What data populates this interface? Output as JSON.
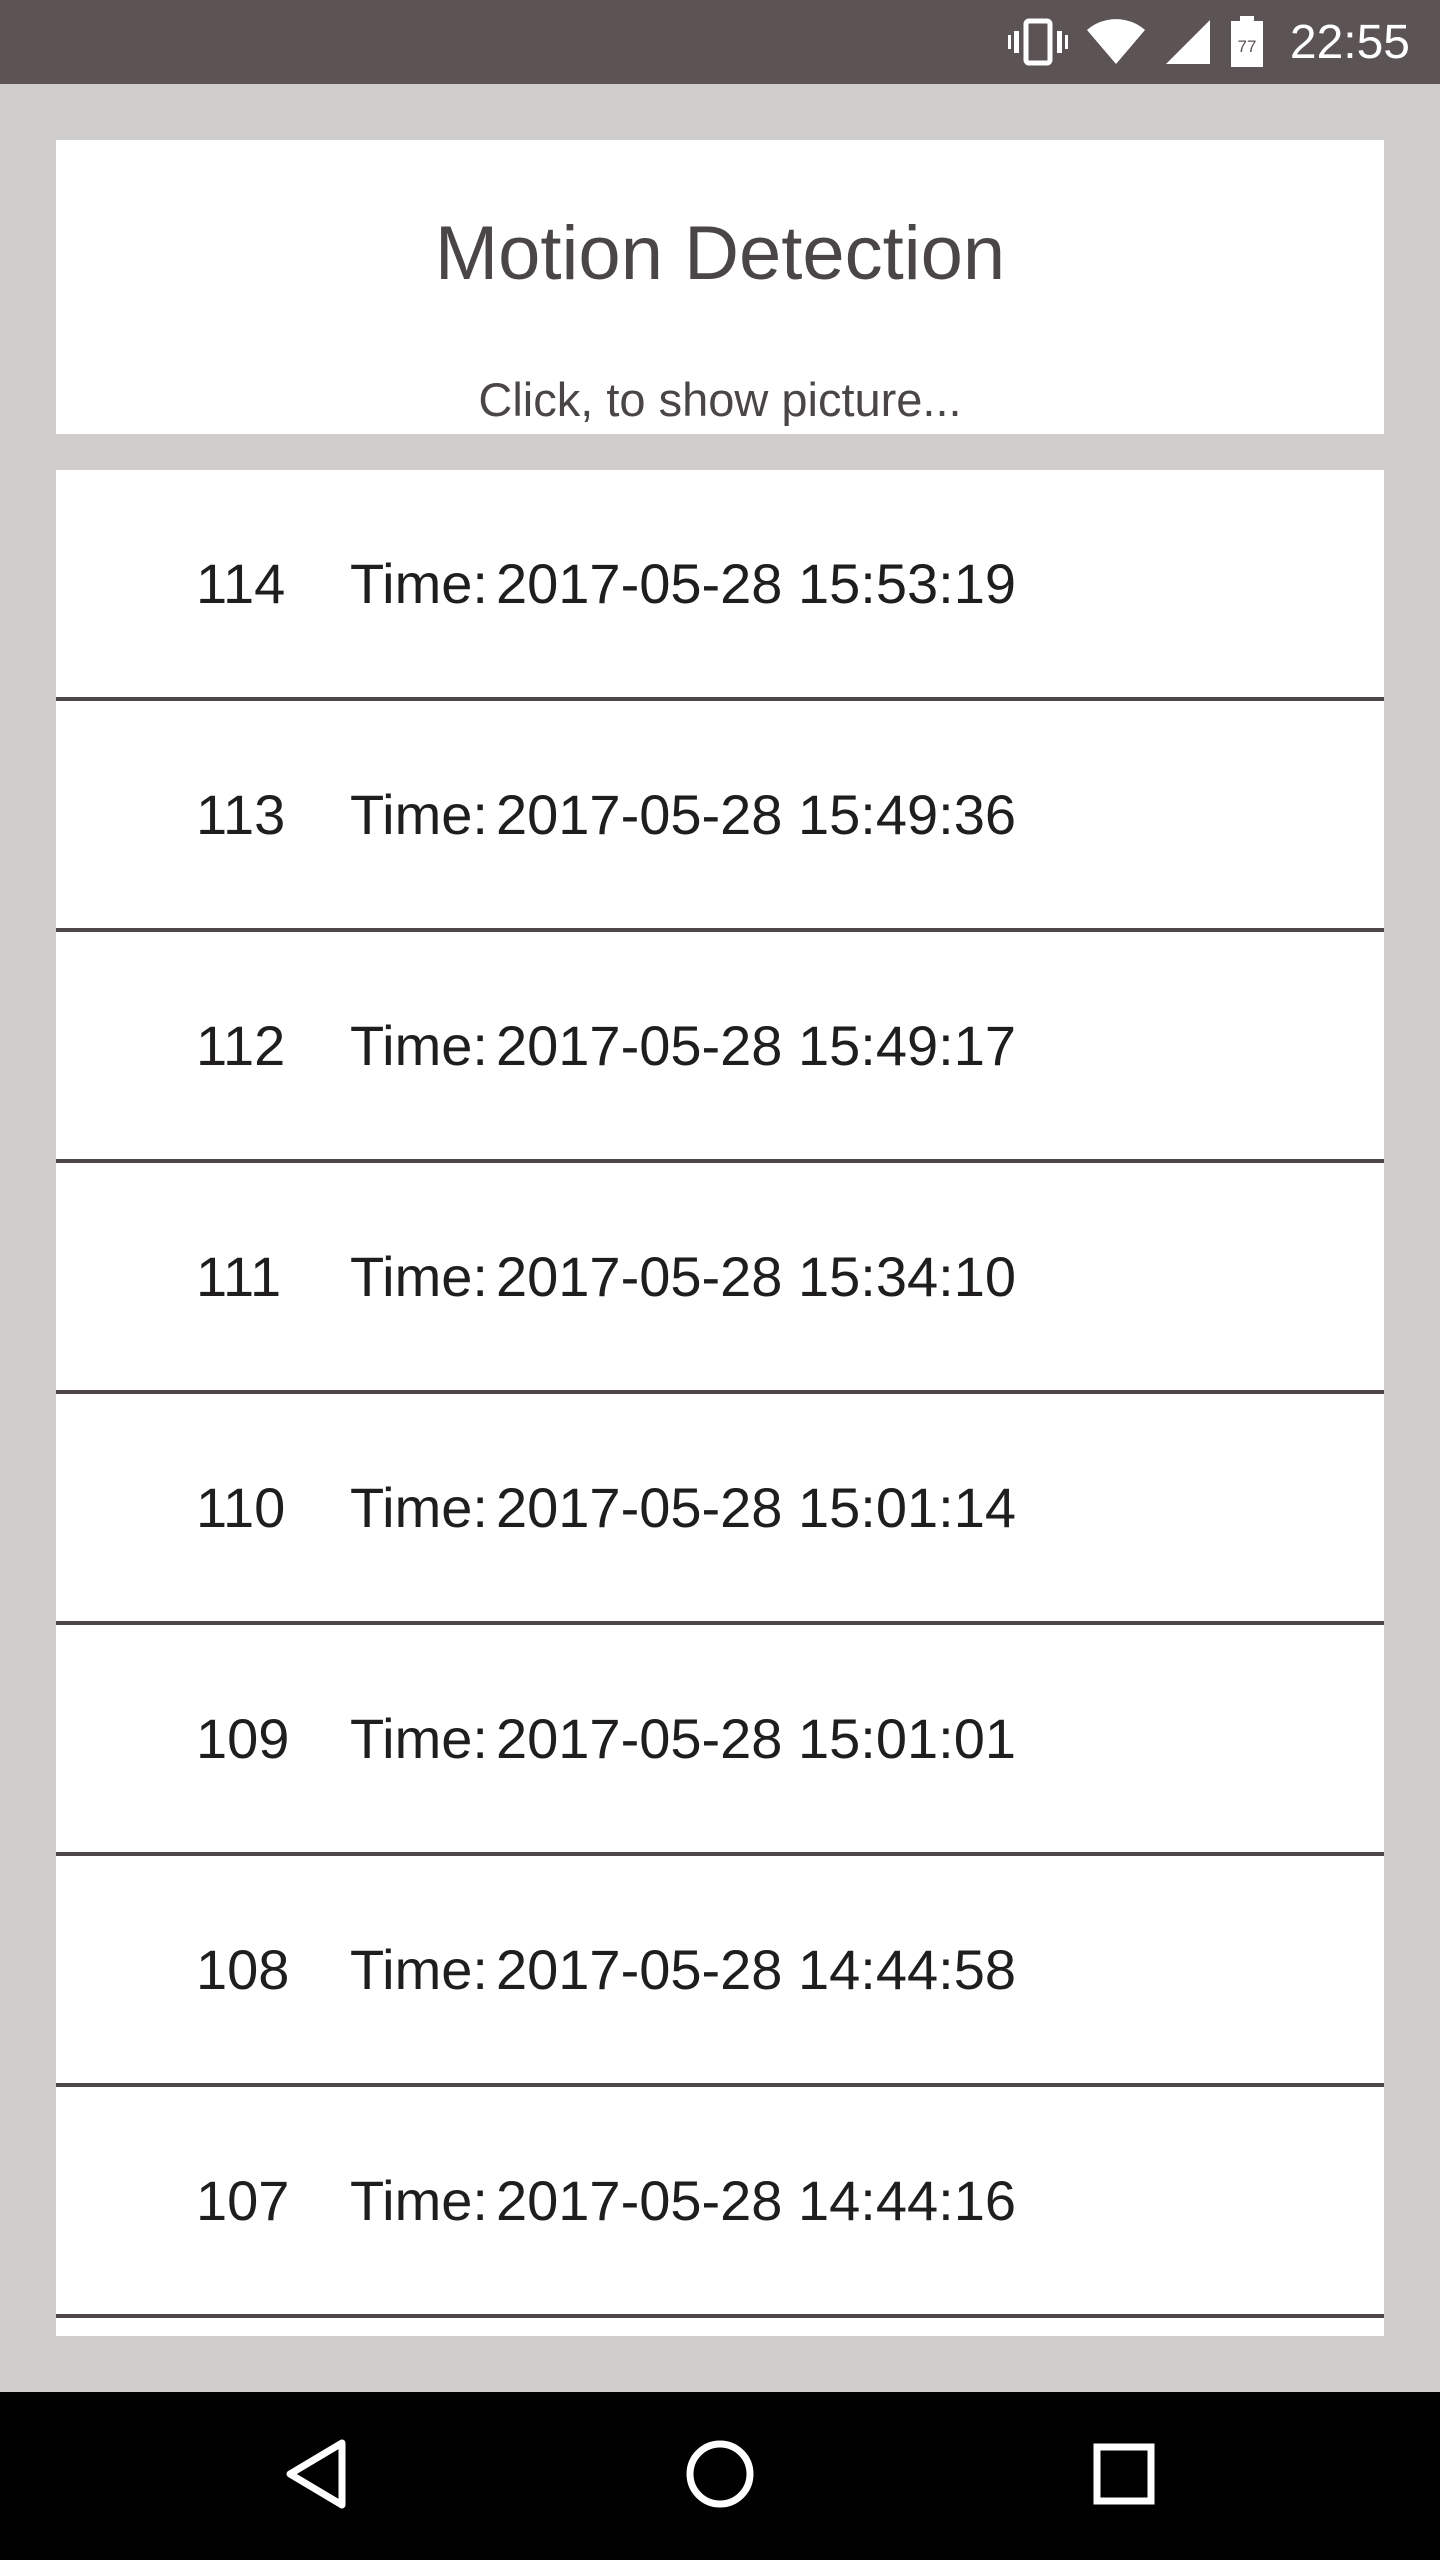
{
  "status_bar": {
    "time": "22:55",
    "battery_level": "77",
    "icons": [
      "vibrate-icon",
      "wifi-icon",
      "signal-icon",
      "battery-icon"
    ]
  },
  "header": {
    "title": "Motion Detection",
    "subtitle": "Click, to show picture..."
  },
  "list": {
    "items": [
      {
        "id": "114",
        "label": "Time:",
        "time": "2017-05-28 15:53:19"
      },
      {
        "id": "113",
        "label": "Time:",
        "time": "2017-05-28 15:49:36"
      },
      {
        "id": "112",
        "label": "Time:",
        "time": "2017-05-28 15:49:17"
      },
      {
        "id": "111",
        "label": "Time:",
        "time": "2017-05-28 15:34:10"
      },
      {
        "id": "110",
        "label": "Time:",
        "time": "2017-05-28 15:01:14"
      },
      {
        "id": "109",
        "label": "Time:",
        "time": "2017-05-28 15:01:01"
      },
      {
        "id": "108",
        "label": "Time:",
        "time": "2017-05-28 14:44:58"
      },
      {
        "id": "107",
        "label": "Time:",
        "time": "2017-05-28 14:44:16"
      }
    ]
  },
  "nav_bar": {
    "icons": [
      "back-icon",
      "home-icon",
      "recents-icon"
    ]
  },
  "colors": {
    "status_bar": "#5b5354",
    "background": "#cfcecd",
    "card": "#ffffff",
    "divider": "#4d4748",
    "nav_bar": "#000000"
  }
}
